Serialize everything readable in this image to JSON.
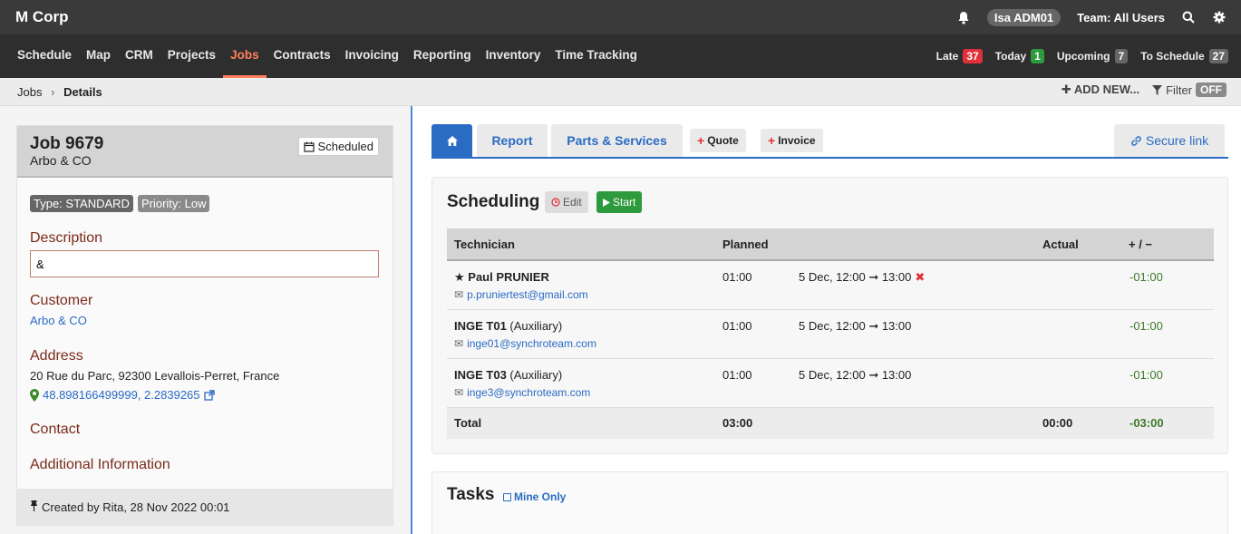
{
  "app": {
    "brand": "M Corp"
  },
  "topbar": {
    "user": "Isa ADM01",
    "team": "Team: All Users"
  },
  "nav": {
    "items": [
      "Schedule",
      "Map",
      "CRM",
      "Projects",
      "Jobs",
      "Contracts",
      "Invoicing",
      "Reporting",
      "Inventory",
      "Time Tracking"
    ],
    "active": "Jobs",
    "counts": [
      {
        "label": "Late",
        "value": "37",
        "color": "#e0303a"
      },
      {
        "label": "Today",
        "value": "1",
        "color": "#2e9a3e"
      },
      {
        "label": "Upcoming",
        "value": "7",
        "color": "#666666"
      },
      {
        "label": "To Schedule",
        "value": "27",
        "color": "#666666"
      }
    ]
  },
  "breadcrumb": {
    "root": "Jobs",
    "current": "Details",
    "add_new": "ADD NEW...",
    "filter": "Filter",
    "filter_state": "OFF"
  },
  "job": {
    "title": "Job 9679",
    "customer_name": "Arbo & CO",
    "status": "Scheduled",
    "type": "Type: STANDARD",
    "priority": "Priority: Low",
    "description_label": "Description",
    "description_value": "&",
    "customer_label": "Customer",
    "customer_link": "Arbo & CO",
    "address_label": "Address",
    "address": "20 Rue du Parc, 92300 Levallois-Perret, France",
    "coordinates": "48.898166499999, 2.2839265",
    "contact_label": "Contact",
    "additional_label": "Additional Information",
    "created": "Created by Rita, 28 Nov 2022 00:01"
  },
  "tabs": {
    "report": "Report",
    "parts": "Parts & Services",
    "quote": "Quote",
    "invoice": "Invoice",
    "secure": "Secure link"
  },
  "scheduling": {
    "title": "Scheduling",
    "edit": "Edit",
    "start": "Start",
    "columns": {
      "technician": "Technician",
      "planned": "Planned",
      "actual": "Actual",
      "diff": "+ / −"
    },
    "rows": [
      {
        "name": "Paul PRUNIER",
        "aux": "",
        "email": "p.pruniertest@gmail.com",
        "planned": "01:00",
        "range": "5 Dec, 12:00 ➞ 13:00",
        "diff": "-01:00"
      },
      {
        "name": "INGE T01",
        "aux": "(Auxiliary)",
        "email": "inge01@synchroteam.com",
        "planned": "01:00",
        "range": "5 Dec, 12:00 ➞ 13:00",
        "diff": "-01:00"
      },
      {
        "name": "INGE T03",
        "aux": "(Auxiliary)",
        "email": "inge3@synchroteam.com",
        "planned": "01:00",
        "range": "5 Dec, 12:00 ➞ 13:00",
        "diff": "-01:00"
      }
    ],
    "total": {
      "label": "Total",
      "planned": "03:00",
      "actual": "00:00",
      "diff": "-03:00"
    }
  },
  "tasks": {
    "title": "Tasks",
    "mine_only": "Mine Only"
  }
}
